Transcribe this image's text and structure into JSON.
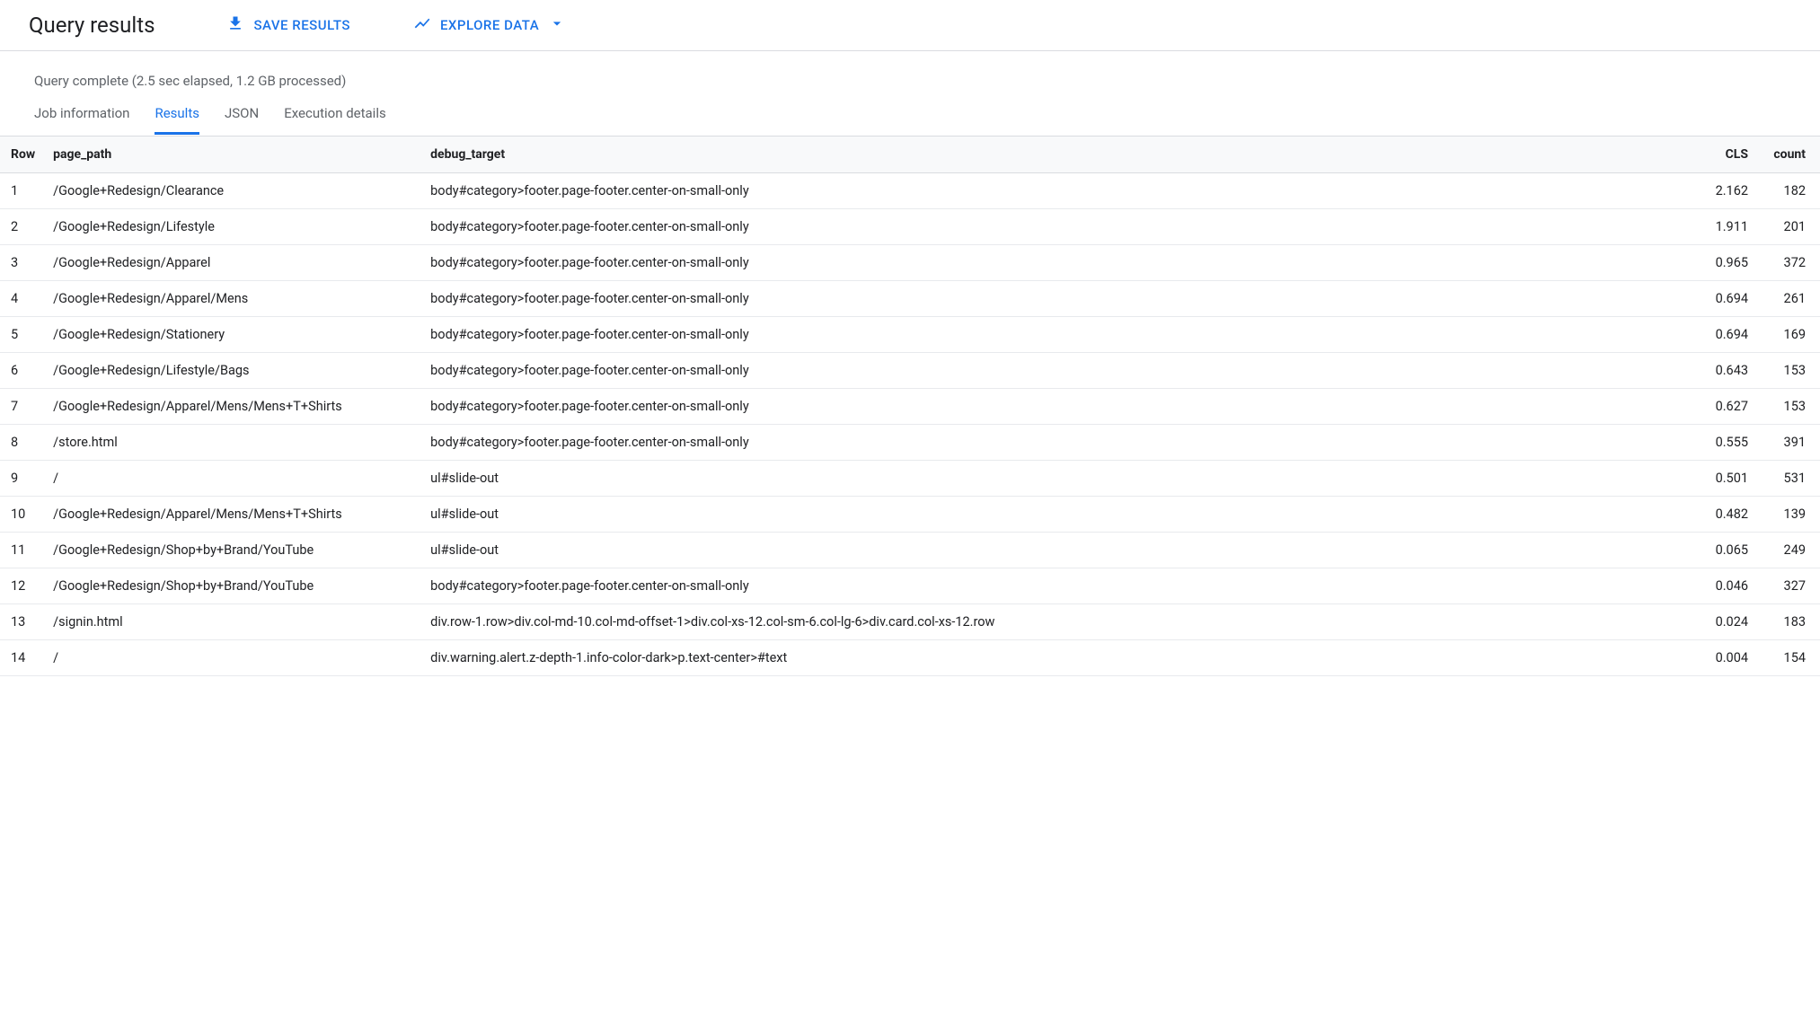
{
  "header": {
    "title": "Query results",
    "save_label": "SAVE RESULTS",
    "explore_label": "EXPLORE DATA"
  },
  "status": "Query complete (2.5 sec elapsed, 1.2 GB processed)",
  "tabs": {
    "job_information": "Job information",
    "results": "Results",
    "json": "JSON",
    "execution_details": "Execution details"
  },
  "columns": {
    "row": "Row",
    "page_path": "page_path",
    "debug_target": "debug_target",
    "cls": "CLS",
    "count": "count"
  },
  "rows": [
    {
      "row": "1",
      "page_path": "/Google+Redesign/Clearance",
      "debug_target": "body#category>footer.page-footer.center-on-small-only",
      "cls": "2.162",
      "count": "182"
    },
    {
      "row": "2",
      "page_path": "/Google+Redesign/Lifestyle",
      "debug_target": "body#category>footer.page-footer.center-on-small-only",
      "cls": "1.911",
      "count": "201"
    },
    {
      "row": "3",
      "page_path": "/Google+Redesign/Apparel",
      "debug_target": "body#category>footer.page-footer.center-on-small-only",
      "cls": "0.965",
      "count": "372"
    },
    {
      "row": "4",
      "page_path": "/Google+Redesign/Apparel/Mens",
      "debug_target": "body#category>footer.page-footer.center-on-small-only",
      "cls": "0.694",
      "count": "261"
    },
    {
      "row": "5",
      "page_path": "/Google+Redesign/Stationery",
      "debug_target": "body#category>footer.page-footer.center-on-small-only",
      "cls": "0.694",
      "count": "169"
    },
    {
      "row": "6",
      "page_path": "/Google+Redesign/Lifestyle/Bags",
      "debug_target": "body#category>footer.page-footer.center-on-small-only",
      "cls": "0.643",
      "count": "153"
    },
    {
      "row": "7",
      "page_path": "/Google+Redesign/Apparel/Mens/Mens+T+Shirts",
      "debug_target": "body#category>footer.page-footer.center-on-small-only",
      "cls": "0.627",
      "count": "153"
    },
    {
      "row": "8",
      "page_path": "/store.html",
      "debug_target": "body#category>footer.page-footer.center-on-small-only",
      "cls": "0.555",
      "count": "391"
    },
    {
      "row": "9",
      "page_path": "/",
      "debug_target": "ul#slide-out",
      "cls": "0.501",
      "count": "531"
    },
    {
      "row": "10",
      "page_path": "/Google+Redesign/Apparel/Mens/Mens+T+Shirts",
      "debug_target": "ul#slide-out",
      "cls": "0.482",
      "count": "139"
    },
    {
      "row": "11",
      "page_path": "/Google+Redesign/Shop+by+Brand/YouTube",
      "debug_target": "ul#slide-out",
      "cls": "0.065",
      "count": "249"
    },
    {
      "row": "12",
      "page_path": "/Google+Redesign/Shop+by+Brand/YouTube",
      "debug_target": "body#category>footer.page-footer.center-on-small-only",
      "cls": "0.046",
      "count": "327"
    },
    {
      "row": "13",
      "page_path": "/signin.html",
      "debug_target": "div.row-1.row>div.col-md-10.col-md-offset-1>div.col-xs-12.col-sm-6.col-lg-6>div.card.col-xs-12.row",
      "cls": "0.024",
      "count": "183"
    },
    {
      "row": "14",
      "page_path": "/",
      "debug_target": "div.warning.alert.z-depth-1.info-color-dark>p.text-center>#text",
      "cls": "0.004",
      "count": "154"
    }
  ]
}
